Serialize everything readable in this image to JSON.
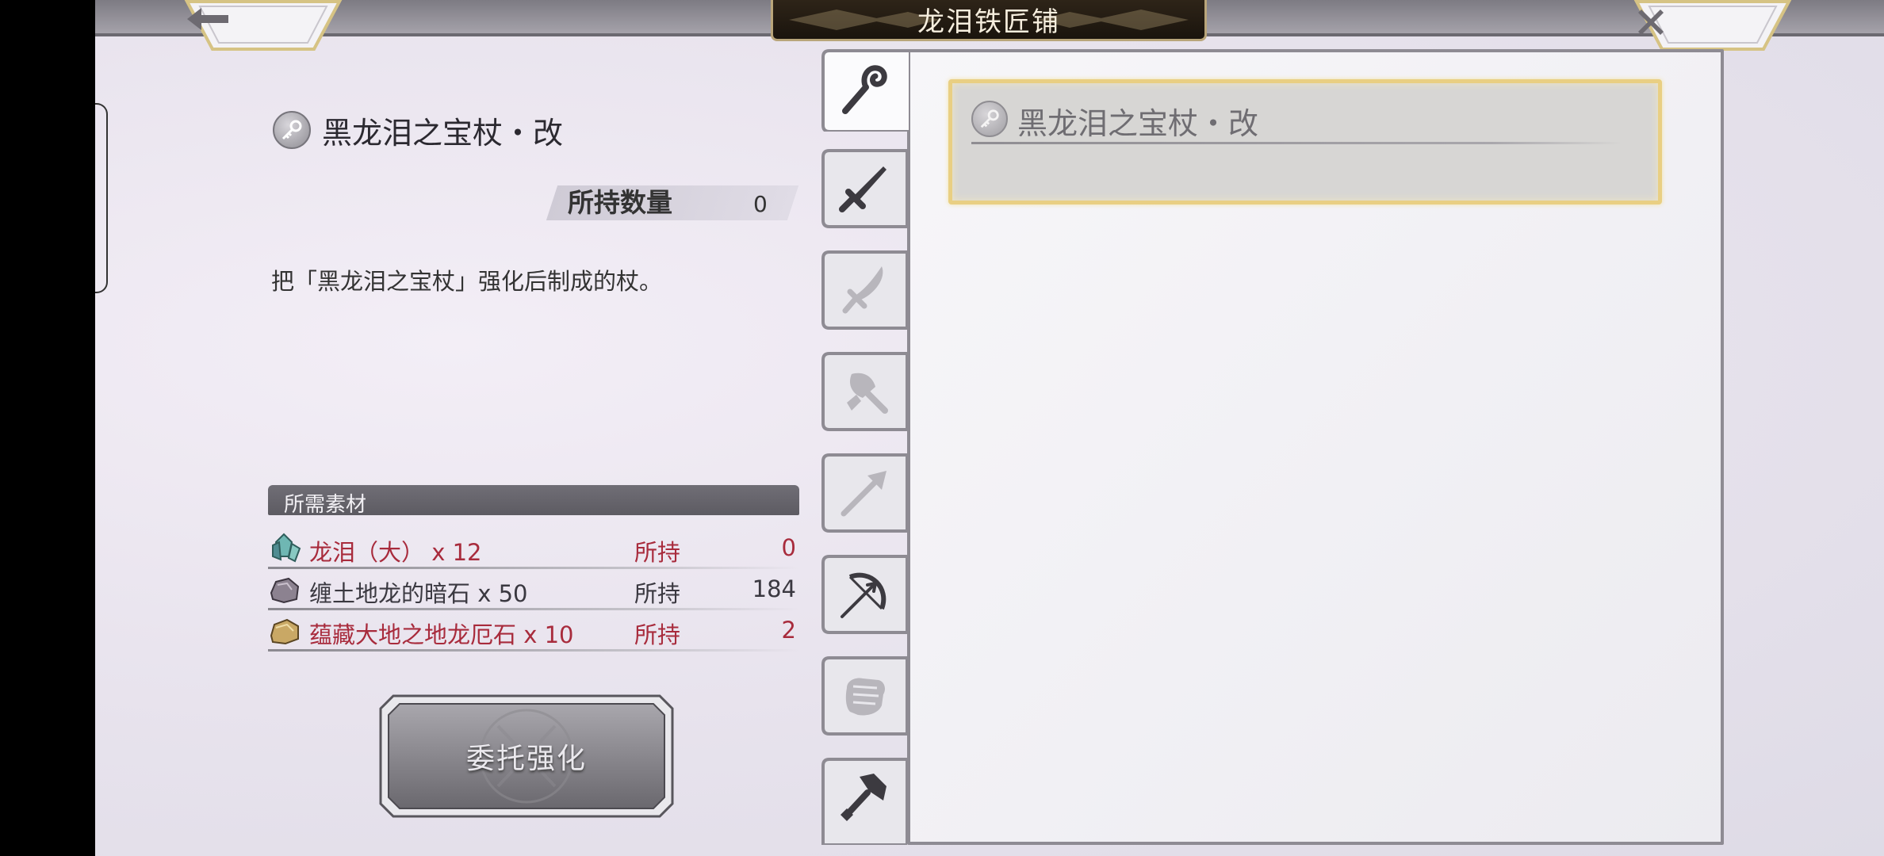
{
  "header": {
    "title": "龙泪铁匠铺",
    "back_icon": "back-arrow-icon",
    "close_icon": "close-icon"
  },
  "item": {
    "name": "黑龙泪之宝杖・改",
    "owned_label": "所持数量",
    "owned_count": "0",
    "description": "把「黑龙泪之宝杖」强化后制成的杖。"
  },
  "materials": {
    "header": "所需素材",
    "rows": [
      {
        "name": "龙泪（大） x 12",
        "hold_label": "所持",
        "count": "0",
        "insufficient": true,
        "icon": "dragon-tear-crystal-icon"
      },
      {
        "name": "缠土地龙的暗石 x 50",
        "hold_label": "所持",
        "count": "184",
        "insufficient": false,
        "icon": "dark-stone-icon"
      },
      {
        "name": "蕴藏大地之地龙厄石 x 10",
        "hold_label": "所持",
        "count": "2",
        "insufficient": true,
        "icon": "earth-dragon-stone-icon"
      }
    ]
  },
  "actions": {
    "commission_label": "委托强化"
  },
  "tabs": [
    {
      "name": "staff",
      "icon": "staff-icon",
      "active": true
    },
    {
      "name": "sword",
      "icon": "sword-icon",
      "active": false
    },
    {
      "name": "dagger",
      "icon": "dagger-icon",
      "active": false
    },
    {
      "name": "axe",
      "icon": "axe-icon",
      "active": false
    },
    {
      "name": "spear",
      "icon": "spear-icon",
      "active": false
    },
    {
      "name": "bow",
      "icon": "bow-icon",
      "active": false
    },
    {
      "name": "fist",
      "icon": "fist-icon",
      "active": false
    },
    {
      "name": "hammer",
      "icon": "hammer-icon",
      "active": false
    }
  ],
  "list": {
    "items": [
      {
        "name": "黑龙泪之宝杖・改",
        "selected": true
      }
    ]
  },
  "colors": {
    "insufficient": "#a82b3c",
    "selected_border": "#e9cf83",
    "title_plate": "#1a140d"
  }
}
